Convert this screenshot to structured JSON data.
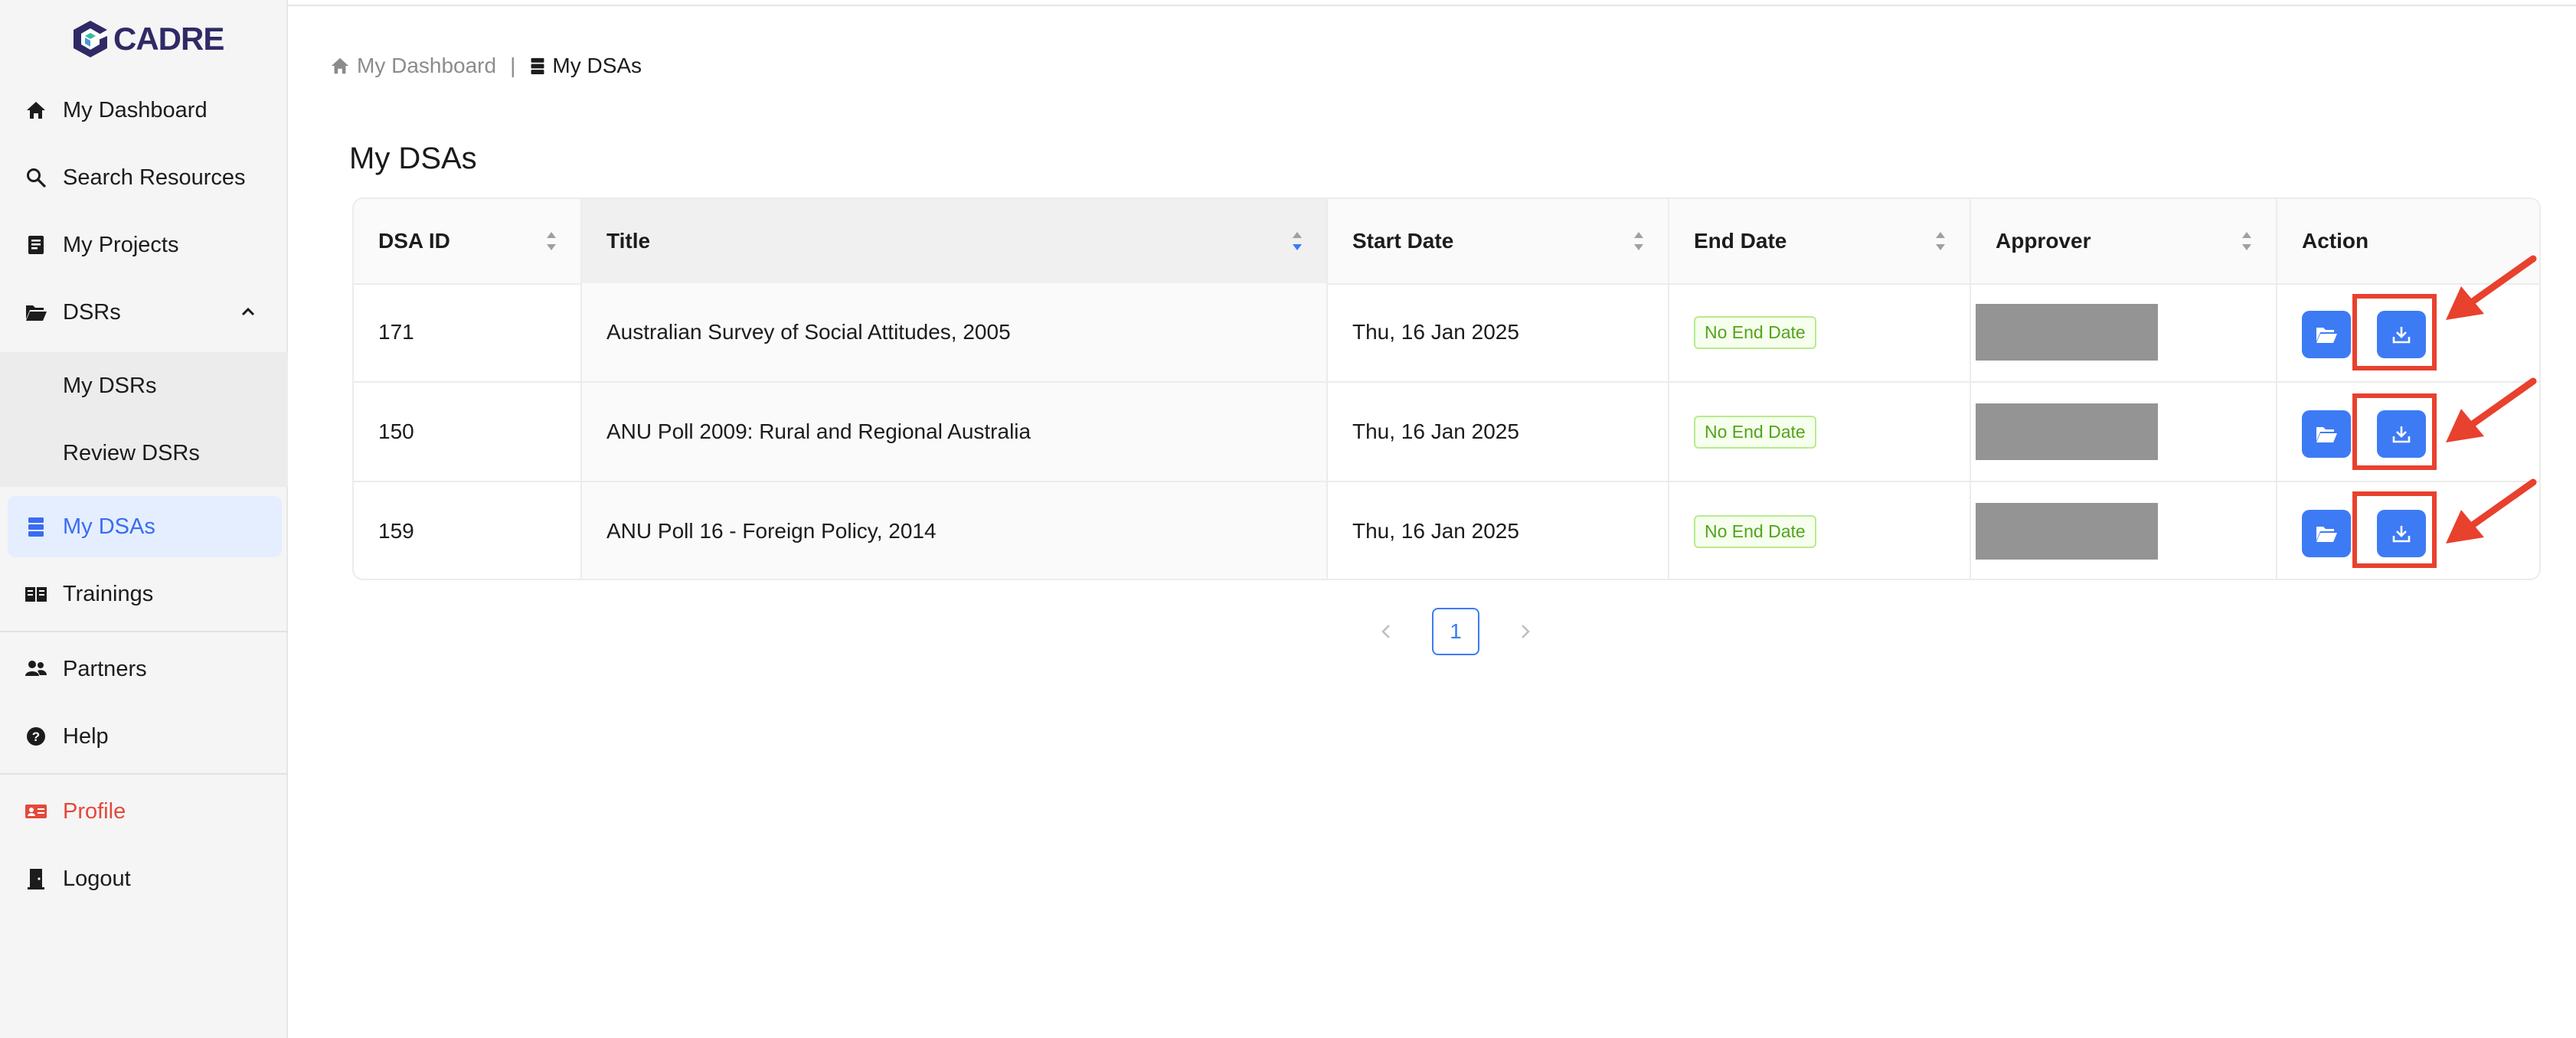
{
  "app": {
    "logo_text": "CADRE"
  },
  "sidebar": {
    "items": [
      {
        "label": "My Dashboard",
        "icon": "home-icon"
      },
      {
        "label": "Search Resources",
        "icon": "search-icon"
      },
      {
        "label": "My Projects",
        "icon": "projects-icon"
      },
      {
        "label": "DSRs",
        "icon": "folder-open-icon",
        "expanded": true
      },
      {
        "label": "My DSRs"
      },
      {
        "label": "Review DSRs"
      },
      {
        "label": "My DSAs",
        "icon": "database-icon",
        "active": true
      },
      {
        "label": "Trainings",
        "icon": "book-icon"
      },
      {
        "label": "Partners",
        "icon": "team-icon"
      },
      {
        "label": "Help",
        "icon": "question-icon"
      },
      {
        "label": "Profile",
        "icon": "id-card-icon"
      },
      {
        "label": "Logout",
        "icon": "logout-icon"
      }
    ]
  },
  "breadcrumb": {
    "home": "My Dashboard",
    "separator": "|",
    "current": "My DSAs"
  },
  "page": {
    "title": "My DSAs"
  },
  "table": {
    "columns": [
      "DSA ID",
      "Title",
      "Start Date",
      "End Date",
      "Approver",
      "Action"
    ],
    "rows": [
      {
        "id": "171",
        "title": "Australian Survey of Social Attitudes, 2005",
        "start": "Thu, 16 Jan 2025",
        "end": "No End Date"
      },
      {
        "id": "150",
        "title": "ANU Poll 2009: Rural and Regional Australia",
        "start": "Thu, 16 Jan 2025",
        "end": "No End Date"
      },
      {
        "id": "159",
        "title": "ANU Poll 16 - Foreign Policy, 2014",
        "start": "Thu, 16 Jan 2025",
        "end": "No End Date"
      }
    ]
  },
  "pagination": {
    "current": "1"
  },
  "colors": {
    "accent": "#3d7bf5",
    "annotation": "#e8412e",
    "tag_green": "#52a41a",
    "profile_red": "#e5483a"
  }
}
